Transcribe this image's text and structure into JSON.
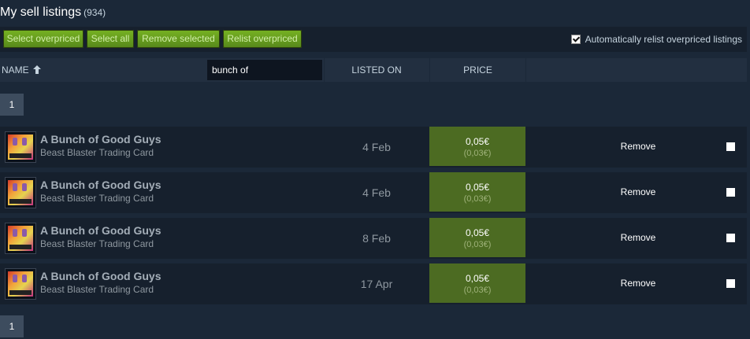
{
  "page": {
    "title": "My sell listings",
    "count": "(934)"
  },
  "toolbar": {
    "buttons": [
      {
        "label": "Select overpriced"
      },
      {
        "label": "Select all"
      },
      {
        "label": "Remove selected"
      },
      {
        "label": "Relist overpriced"
      }
    ],
    "auto_relist_label": "Automatically relist overpriced listings",
    "auto_relist_checked": true
  },
  "table": {
    "headers": {
      "name": "NAME",
      "listed_on": "LISTED ON",
      "price": "PRICE"
    },
    "sort_icon": "arrow-up-icon",
    "search_value": "bunch of",
    "rows": [
      {
        "name": "A Bunch of Good Guys",
        "game": "Beast Blaster Trading Card",
        "listed_on": "4 Feb",
        "price": "0,05€",
        "price_sub": "(0,03€)",
        "action": "Remove"
      },
      {
        "name": "A Bunch of Good Guys",
        "game": "Beast Blaster Trading Card",
        "listed_on": "4 Feb",
        "price": "0,05€",
        "price_sub": "(0,03€)",
        "action": "Remove"
      },
      {
        "name": "A Bunch of Good Guys",
        "game": "Beast Blaster Trading Card",
        "listed_on": "8 Feb",
        "price": "0,05€",
        "price_sub": "(0,03€)",
        "action": "Remove"
      },
      {
        "name": "A Bunch of Good Guys",
        "game": "Beast Blaster Trading Card",
        "listed_on": "17 Apr",
        "price": "0,05€",
        "price_sub": "(0,03€)",
        "action": "Remove"
      }
    ]
  },
  "pagination": {
    "top_page": "1",
    "bottom_page": "1"
  },
  "colors": {
    "background": "#1b2838",
    "button_green": "#75b022",
    "price_green": "#4c6b22"
  }
}
